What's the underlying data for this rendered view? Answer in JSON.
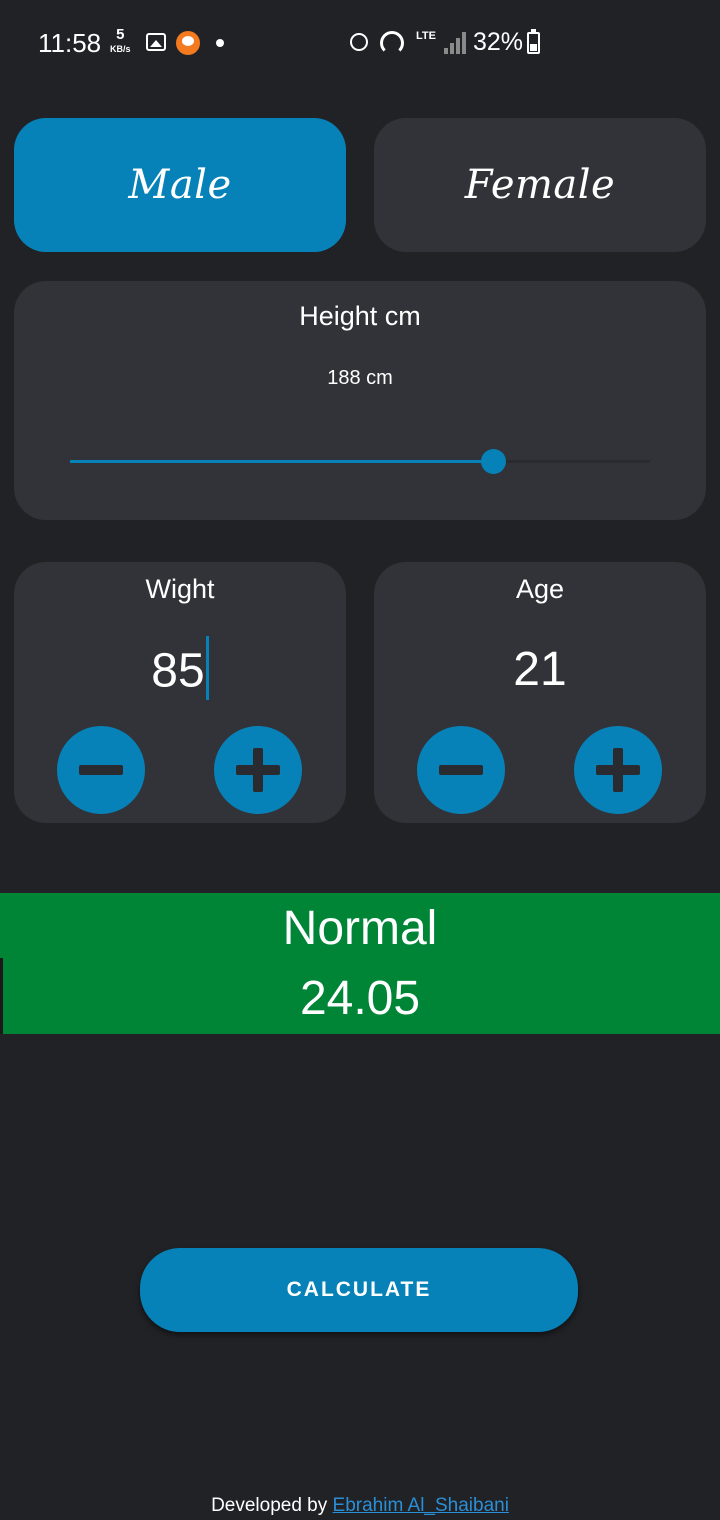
{
  "status_bar": {
    "time": "11:58",
    "net_speed": "5",
    "net_unit": "KB/s",
    "network_type": "LTE",
    "battery": "32%"
  },
  "gender": {
    "male_label": "Male",
    "female_label": "Female",
    "selected": "Male"
  },
  "height": {
    "title": "Height cm",
    "value_label": "188 cm",
    "slider_fraction": 0.73
  },
  "weight": {
    "title": "Wight",
    "value": "85"
  },
  "age": {
    "title": "Age",
    "value": "21"
  },
  "result": {
    "status": "Normal",
    "bmi": "24.05",
    "color": "#008537"
  },
  "calculate_label": "CALCULATE",
  "footer": {
    "prefix": "Developed by",
    "author": "Ebrahim Al_Shaibani"
  },
  "colors": {
    "accent": "#0682b8",
    "background": "#212226",
    "card": "#323338"
  }
}
